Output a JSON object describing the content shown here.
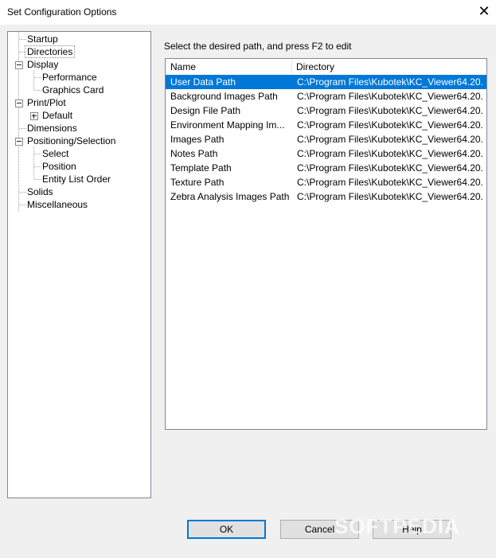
{
  "window": {
    "title": "Set Configuration Options",
    "close_glyph": "✕"
  },
  "tree": {
    "items": [
      {
        "label": "Startup"
      },
      {
        "label": "Directories"
      },
      {
        "label": "Display"
      },
      {
        "label": "Performance"
      },
      {
        "label": "Graphics Card"
      },
      {
        "label": "Print/Plot"
      },
      {
        "label": "Default"
      },
      {
        "label": "Dimensions"
      },
      {
        "label": "Positioning/Selection"
      },
      {
        "label": "Select"
      },
      {
        "label": "Position"
      },
      {
        "label": "Entity List Order"
      },
      {
        "label": "Solids"
      },
      {
        "label": "Miscellaneous"
      }
    ],
    "selected": "Directories"
  },
  "main": {
    "prompt": "Select the desired path, and press F2 to edit",
    "columns": [
      "Name",
      "Directory"
    ],
    "rows": [
      {
        "name": "User Data Path",
        "directory": "C:\\Program Files\\Kubotek\\KC_Viewer64.20..."
      },
      {
        "name": "Background Images Path",
        "directory": "C:\\Program Files\\Kubotek\\KC_Viewer64.20..."
      },
      {
        "name": "Design File Path",
        "directory": "C:\\Program Files\\Kubotek\\KC_Viewer64.20..."
      },
      {
        "name": "Environment Mapping Im...",
        "directory": "C:\\Program Files\\Kubotek\\KC_Viewer64.20..."
      },
      {
        "name": "Images Path",
        "directory": "C:\\Program Files\\Kubotek\\KC_Viewer64.20..."
      },
      {
        "name": "Notes Path",
        "directory": "C:\\Program Files\\Kubotek\\KC_Viewer64.20..."
      },
      {
        "name": "Template Path",
        "directory": "C:\\Program Files\\Kubotek\\KC_Viewer64.20..."
      },
      {
        "name": "Texture Path",
        "directory": "C:\\Program Files\\Kubotek\\KC_Viewer64.20..."
      },
      {
        "name": "Zebra Analysis Images Path",
        "directory": "C:\\Program Files\\Kubotek\\KC_Viewer64.20..."
      }
    ],
    "selected_row": "User Data Path"
  },
  "buttons": {
    "ok": "OK",
    "cancel": "Cancel",
    "help": "Help"
  },
  "watermark": "SOFTPEDIA",
  "colors": {
    "selection": "#0078d7",
    "window_bg": "#f0f0f0"
  }
}
